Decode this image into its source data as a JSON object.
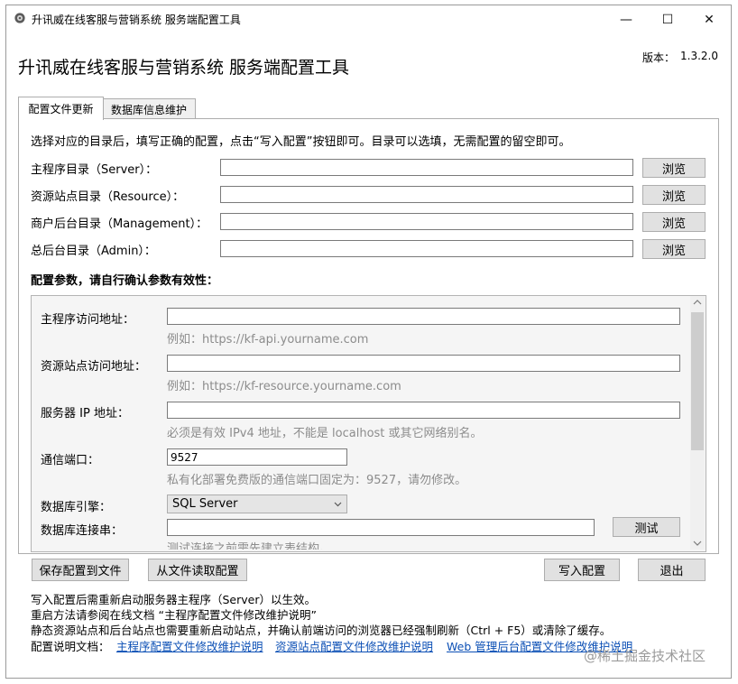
{
  "window": {
    "title": "升讯威在线客服与营销系统 服务端配置工具",
    "controls": {
      "minimize": "—",
      "maximize": "☐",
      "close": "✕"
    }
  },
  "header": {
    "app_title": "升讯威在线客服与营销系统 服务端配置工具",
    "version_label": "版本：",
    "version_value": "1.3.2.0"
  },
  "tabs": [
    {
      "label": "配置文件更新",
      "active": true
    },
    {
      "label": "数据库信息维护",
      "active": false
    }
  ],
  "directory_section": {
    "instruction": "选择对应的目录后，填写正确的配置，点击“写入配置”按钮即可。目录可以选填，无需配置的留空即可。",
    "rows": [
      {
        "label": "主程序目录（Server）：",
        "value": "",
        "browse_label": "浏览"
      },
      {
        "label": "资源站点目录（Resource）：",
        "value": "",
        "browse_label": "浏览"
      },
      {
        "label": "商户后台目录（Management）：",
        "value": "",
        "browse_label": "浏览"
      },
      {
        "label": "总后台目录（Admin）：",
        "value": "",
        "browse_label": "浏览"
      }
    ]
  },
  "params_section": {
    "heading": "配置参数，请自行确认参数有效性：",
    "fields": [
      {
        "label": "主程序访问地址：",
        "value": "",
        "hint": "例如：https://kf-api.yourname.com"
      },
      {
        "label": "资源站点访问地址：",
        "value": "",
        "hint": "例如：https://kf-resource.yourname.com"
      },
      {
        "label": "服务器 IP 地址：",
        "value": "",
        "hint": "必须是有效 IPv4 地址，不能是 localhost 或其它网络别名。"
      },
      {
        "label": "通信端口：",
        "value": "9527",
        "hint": "私有化部署免费版的通信端口固定为：9527，请勿修改。"
      },
      {
        "label": "数据库引擎：",
        "selected": "SQL Server"
      },
      {
        "label": "数据库连接串：",
        "value": "",
        "test_label": "测试",
        "hint": "测试连接之前需先建立表结构。"
      }
    ]
  },
  "buttons": {
    "save_to_file": "保存配置到文件",
    "load_from_file": "从文件读取配置",
    "write_config": "写入配置",
    "exit": "退出"
  },
  "notes": {
    "line1": "写入配置后需重新启动服务器主程序（Server）以生效。",
    "line2": "重启方法请参阅在线文档 “主程序配置文件修改维护说明”",
    "line3": "静态资源站点和后台站点也需要重新启动站点，并确认前端访问的浏览器已经强制刷新（Ctrl + F5）或清除了缓存。",
    "docs_label": "配置说明文档：",
    "links": [
      "主程序配置文件修改维护说明",
      "资源站点配置文件修改维护说明",
      "Web 管理后台配置文件修改维护说明"
    ]
  },
  "watermark": "@稀土掘金技术社区",
  "icons": {
    "app": "gear-icon",
    "dropdown": "chevron-down-icon",
    "scroll_up": "scroll-up-icon",
    "scroll_down": "scroll-down-icon"
  },
  "colors": {
    "link": "#0b4fb5",
    "hint": "#8c8c8c",
    "button_face": "#e1e1e1"
  }
}
